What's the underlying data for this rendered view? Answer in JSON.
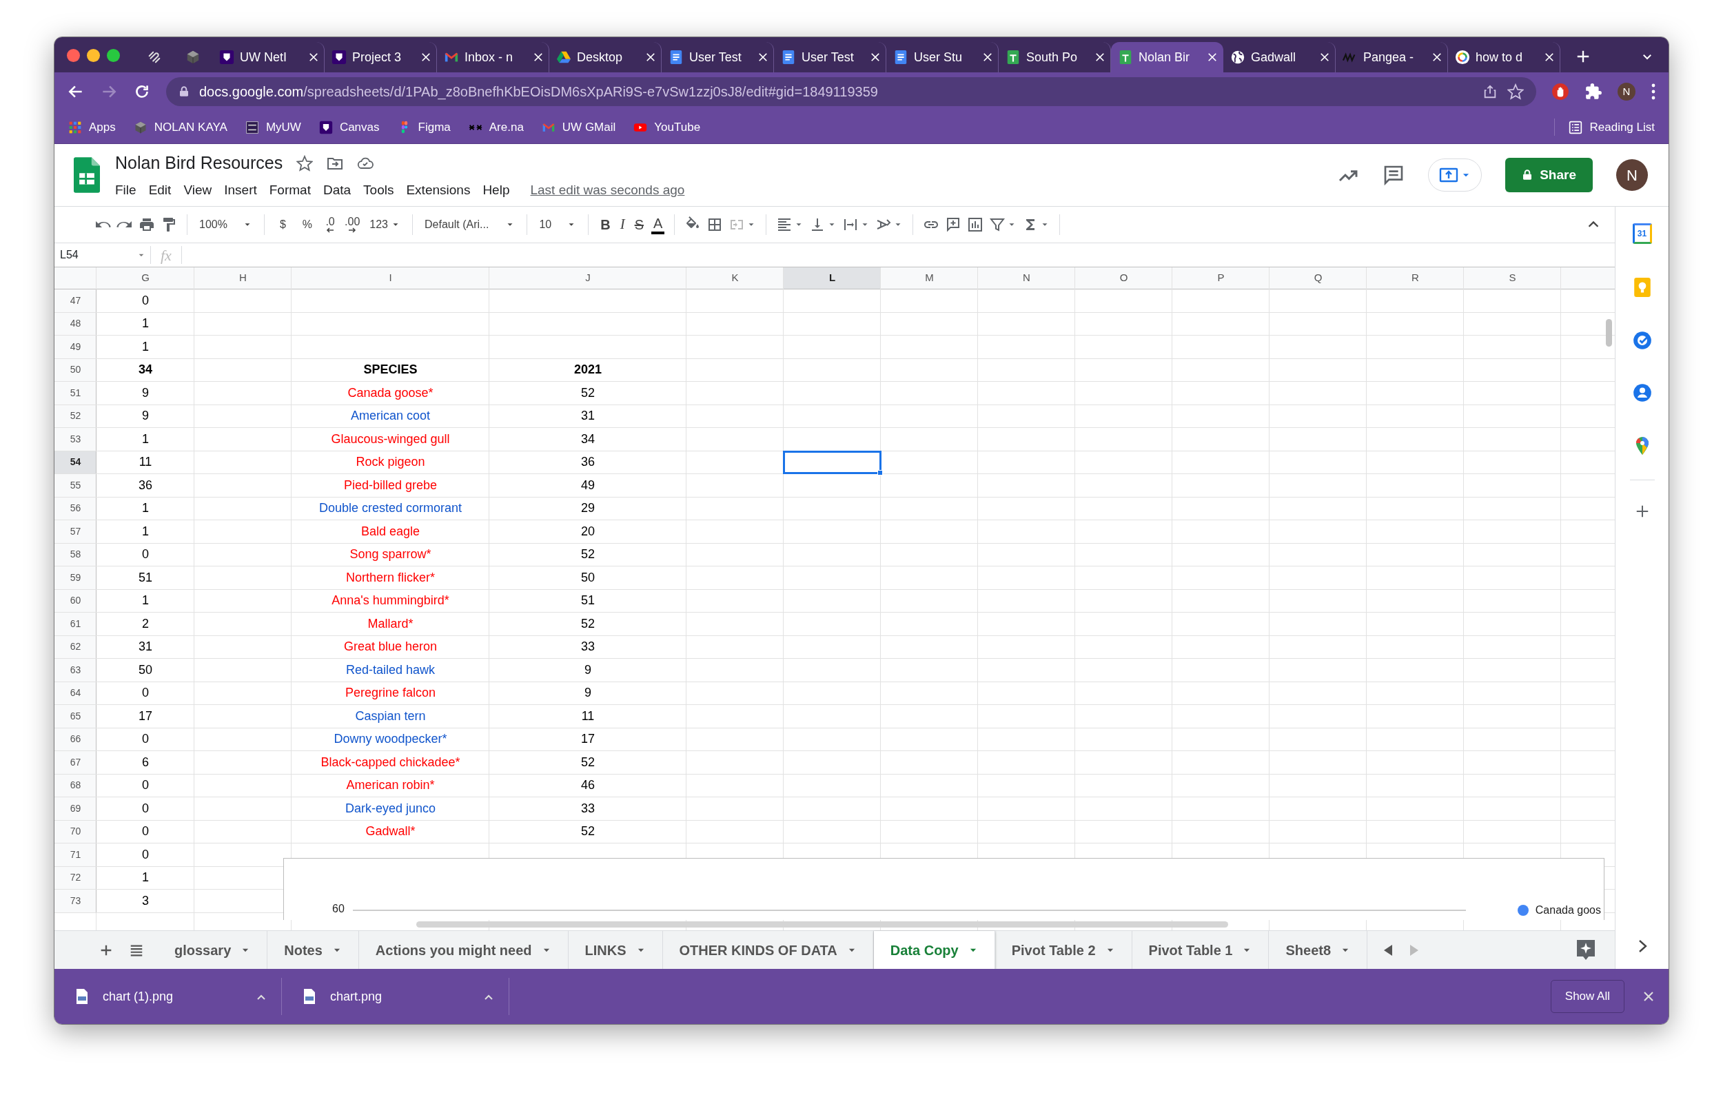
{
  "browser": {
    "pinned_tabs": [
      {
        "kind": "swirl"
      },
      {
        "kind": "cube"
      }
    ],
    "tabs": [
      {
        "title": "UW NetI",
        "kind": "uw",
        "selected": false
      },
      {
        "title": "Project 3",
        "kind": "uw",
        "selected": false
      },
      {
        "title": "Inbox - n",
        "kind": "gmail",
        "selected": false
      },
      {
        "title": "Desktop",
        "kind": "drive",
        "selected": false
      },
      {
        "title": "User Test",
        "kind": "docs",
        "selected": false
      },
      {
        "title": "User Test",
        "kind": "docs",
        "selected": false
      },
      {
        "title": "User Stu",
        "kind": "docs",
        "selected": false
      },
      {
        "title": "South Po",
        "kind": "sheets",
        "selected": false
      },
      {
        "title": "Nolan Bir",
        "kind": "sheets",
        "selected": true
      },
      {
        "title": "Gadwall",
        "kind": "globe",
        "selected": false
      },
      {
        "title": "Pangea -",
        "kind": "zigzag",
        "selected": false
      },
      {
        "title": "how to d",
        "kind": "google",
        "selected": false
      }
    ],
    "url_host": "docs.google.com",
    "url_path": "/spreadsheets/d/1PAb_z8oBnefhKbEOisDM6sXpARi9S-e7vSw1zzj0sJ8/edit#gid=1849119359",
    "profile": "N",
    "bookmarks": [
      {
        "label": "Apps",
        "kind": "apps"
      },
      {
        "label": "NOLAN KAYA",
        "kind": "cube"
      },
      {
        "label": "MyUW",
        "kind": "myuw"
      },
      {
        "label": "Canvas",
        "kind": "uw"
      },
      {
        "label": "Figma",
        "kind": "figma"
      },
      {
        "label": "Are.na",
        "kind": "arena"
      },
      {
        "label": "UW GMail",
        "kind": "gmail"
      },
      {
        "label": "YouTube",
        "kind": "youtube"
      }
    ],
    "reading_list": "Reading List"
  },
  "sheets": {
    "title": "Nolan Bird Resources",
    "menu": [
      "File",
      "Edit",
      "View",
      "Insert",
      "Format",
      "Data",
      "Tools",
      "Extensions",
      "Help"
    ],
    "last_edit": "Last edit was seconds ago",
    "share": "Share",
    "avatar": "N",
    "toolbar": [
      [
        {
          "kind": "undo"
        },
        {
          "kind": "redo"
        },
        {
          "kind": "print"
        },
        {
          "kind": "paint-format"
        }
      ],
      [
        {
          "kind": "dropdown",
          "label": "100%"
        }
      ],
      [
        {
          "kind": "text",
          "label": "$"
        },
        {
          "kind": "text",
          "label": "%"
        },
        {
          "kind": "decimal-less",
          "label": ".0"
        },
        {
          "kind": "decimal-more",
          "label": ".00"
        },
        {
          "kind": "dropdown",
          "label": "123"
        }
      ],
      [
        {
          "kind": "dropdown",
          "label": "Default (Ari..."
        }
      ],
      [
        {
          "kind": "dropdown",
          "label": "10"
        }
      ],
      [
        {
          "kind": "bold",
          "label": "B"
        },
        {
          "kind": "italic",
          "label": "I"
        },
        {
          "kind": "strike",
          "label": "S"
        },
        {
          "kind": "text-color",
          "label": "A"
        }
      ],
      [
        {
          "kind": "fill"
        },
        {
          "kind": "borders"
        },
        {
          "kind": "merge"
        }
      ],
      [
        {
          "kind": "align"
        },
        {
          "kind": "valign"
        },
        {
          "kind": "wrap"
        },
        {
          "kind": "rotate"
        }
      ],
      [
        {
          "kind": "link"
        },
        {
          "kind": "comment"
        },
        {
          "kind": "chart"
        },
        {
          "kind": "filter"
        },
        {
          "kind": "functions"
        }
      ]
    ],
    "name_box": "L54",
    "formula_label": "fx",
    "columns": [
      {
        "label": "G",
        "selected": false
      },
      {
        "label": "H",
        "selected": false
      },
      {
        "label": "I",
        "selected": false
      },
      {
        "label": "J",
        "selected": false
      },
      {
        "label": "K",
        "selected": false
      },
      {
        "label": "L",
        "selected": true
      },
      {
        "label": "M",
        "selected": false
      },
      {
        "label": "N",
        "selected": false
      },
      {
        "label": "O",
        "selected": false
      },
      {
        "label": "P",
        "selected": false
      },
      {
        "label": "Q",
        "selected": false
      },
      {
        "label": "R",
        "selected": false
      },
      {
        "label": "S",
        "selected": false
      }
    ],
    "rows": [
      {
        "number": "47",
        "g": "0",
        "kind": "plain",
        "selected": false
      },
      {
        "number": "48",
        "g": "1",
        "kind": "plain",
        "selected": false
      },
      {
        "number": "49",
        "g": "1",
        "kind": "plain",
        "selected": false
      },
      {
        "number": "50",
        "g": "34",
        "i": "SPECIES",
        "j": "2021",
        "kind": "header",
        "selected": false
      },
      {
        "number": "51",
        "g": "9",
        "i": "Canada goose*",
        "j": "52",
        "kind": "species",
        "color": "#ff0000",
        "selected": false
      },
      {
        "number": "52",
        "g": "9",
        "i": "American coot",
        "j": "31",
        "kind": "species",
        "color": "#1155cc",
        "selected": false
      },
      {
        "number": "53",
        "g": "1",
        "i": "Glaucous-winged gull",
        "j": "34",
        "kind": "species",
        "color": "#ff0000",
        "selected": false
      },
      {
        "number": "54",
        "g": "11",
        "i": "Rock pigeon",
        "j": "36",
        "kind": "species",
        "color": "#ff0000",
        "selected": true
      },
      {
        "number": "55",
        "g": "36",
        "i": "Pied-billed grebe",
        "j": "49",
        "kind": "species",
        "color": "#ff0000",
        "selected": false
      },
      {
        "number": "56",
        "g": "1",
        "i": "Double crested cormorant",
        "j": "29",
        "kind": "species",
        "color": "#1155cc",
        "selected": false
      },
      {
        "number": "57",
        "g": "1",
        "i": "Bald eagle",
        "j": "20",
        "kind": "species",
        "color": "#ff0000",
        "selected": false
      },
      {
        "number": "58",
        "g": "0",
        "i": "Song sparrow*",
        "j": "52",
        "kind": "species",
        "color": "#ff0000",
        "selected": false
      },
      {
        "number": "59",
        "g": "51",
        "i": "Northern flicker*",
        "j": "50",
        "kind": "species",
        "color": "#ff0000",
        "selected": false
      },
      {
        "number": "60",
        "g": "1",
        "i": "Anna's hummingbird*",
        "j": "51",
        "kind": "species",
        "color": "#ff0000",
        "selected": false
      },
      {
        "number": "61",
        "g": "2",
        "i": "Mallard*",
        "j": "52",
        "kind": "species",
        "color": "#ff0000",
        "selected": false
      },
      {
        "number": "62",
        "g": "31",
        "i": "Great blue heron",
        "j": "33",
        "kind": "species",
        "color": "#ff0000",
        "selected": false
      },
      {
        "number": "63",
        "g": "50",
        "i": "Red-tailed hawk",
        "j": "9",
        "kind": "species",
        "color": "#1155cc",
        "selected": false
      },
      {
        "number": "64",
        "g": "0",
        "i": "Peregrine falcon",
        "j": "9",
        "kind": "species",
        "color": "#ff0000",
        "selected": false
      },
      {
        "number": "65",
        "g": "17",
        "i": "Caspian tern",
        "j": "11",
        "kind": "species",
        "color": "#1155cc",
        "selected": false
      },
      {
        "number": "66",
        "g": "0",
        "i": "Downy woodpecker*",
        "j": "17",
        "kind": "species",
        "color": "#1155cc",
        "selected": false
      },
      {
        "number": "67",
        "g": "6",
        "i": "Black-capped chickadee*",
        "j": "52",
        "kind": "species",
        "color": "#ff0000",
        "selected": false
      },
      {
        "number": "68",
        "g": "0",
        "i": "American robin*",
        "j": "46",
        "kind": "species",
        "color": "#ff0000",
        "selected": false
      },
      {
        "number": "69",
        "g": "0",
        "i": "Dark-eyed junco",
        "j": "33",
        "kind": "species",
        "color": "#1155cc",
        "selected": false
      },
      {
        "number": "70",
        "g": "0",
        "i": "Gadwall*",
        "j": "52",
        "kind": "species",
        "color": "#ff0000",
        "selected": false
      },
      {
        "number": "71",
        "g": "0",
        "kind": "plain",
        "selected": false
      },
      {
        "number": "72",
        "g": "1",
        "kind": "plain",
        "selected": false
      },
      {
        "number": "73",
        "g": "3",
        "kind": "plain",
        "selected": false
      }
    ],
    "embedded_chart": {
      "tick": "60",
      "legend": [
        {
          "label": "Canada goos",
          "color": "#4285f4"
        }
      ]
    },
    "sheet_tabs": [
      {
        "label": "glossary",
        "selected": false
      },
      {
        "label": "Notes",
        "selected": false
      },
      {
        "label": "Actions you might need",
        "selected": false
      },
      {
        "label": "LINKS",
        "selected": false
      },
      {
        "label": "OTHER KINDS OF DATA",
        "selected": false
      },
      {
        "label": "Data Copy",
        "selected": true
      },
      {
        "label": "Pivot Table 2",
        "selected": false
      },
      {
        "label": "Pivot Table 1",
        "selected": false
      },
      {
        "label": "Sheet8",
        "selected": false
      }
    ],
    "side_panel": [
      {
        "kind": "calendar",
        "label": "31"
      },
      {
        "kind": "keep"
      },
      {
        "kind": "tasks"
      },
      {
        "kind": "contacts"
      },
      {
        "kind": "maps"
      },
      {
        "kind": "add"
      }
    ]
  },
  "downloads": {
    "files": [
      {
        "name": "chart (1).png"
      },
      {
        "name": "chart.png"
      }
    ],
    "show_all": "Show All"
  }
}
